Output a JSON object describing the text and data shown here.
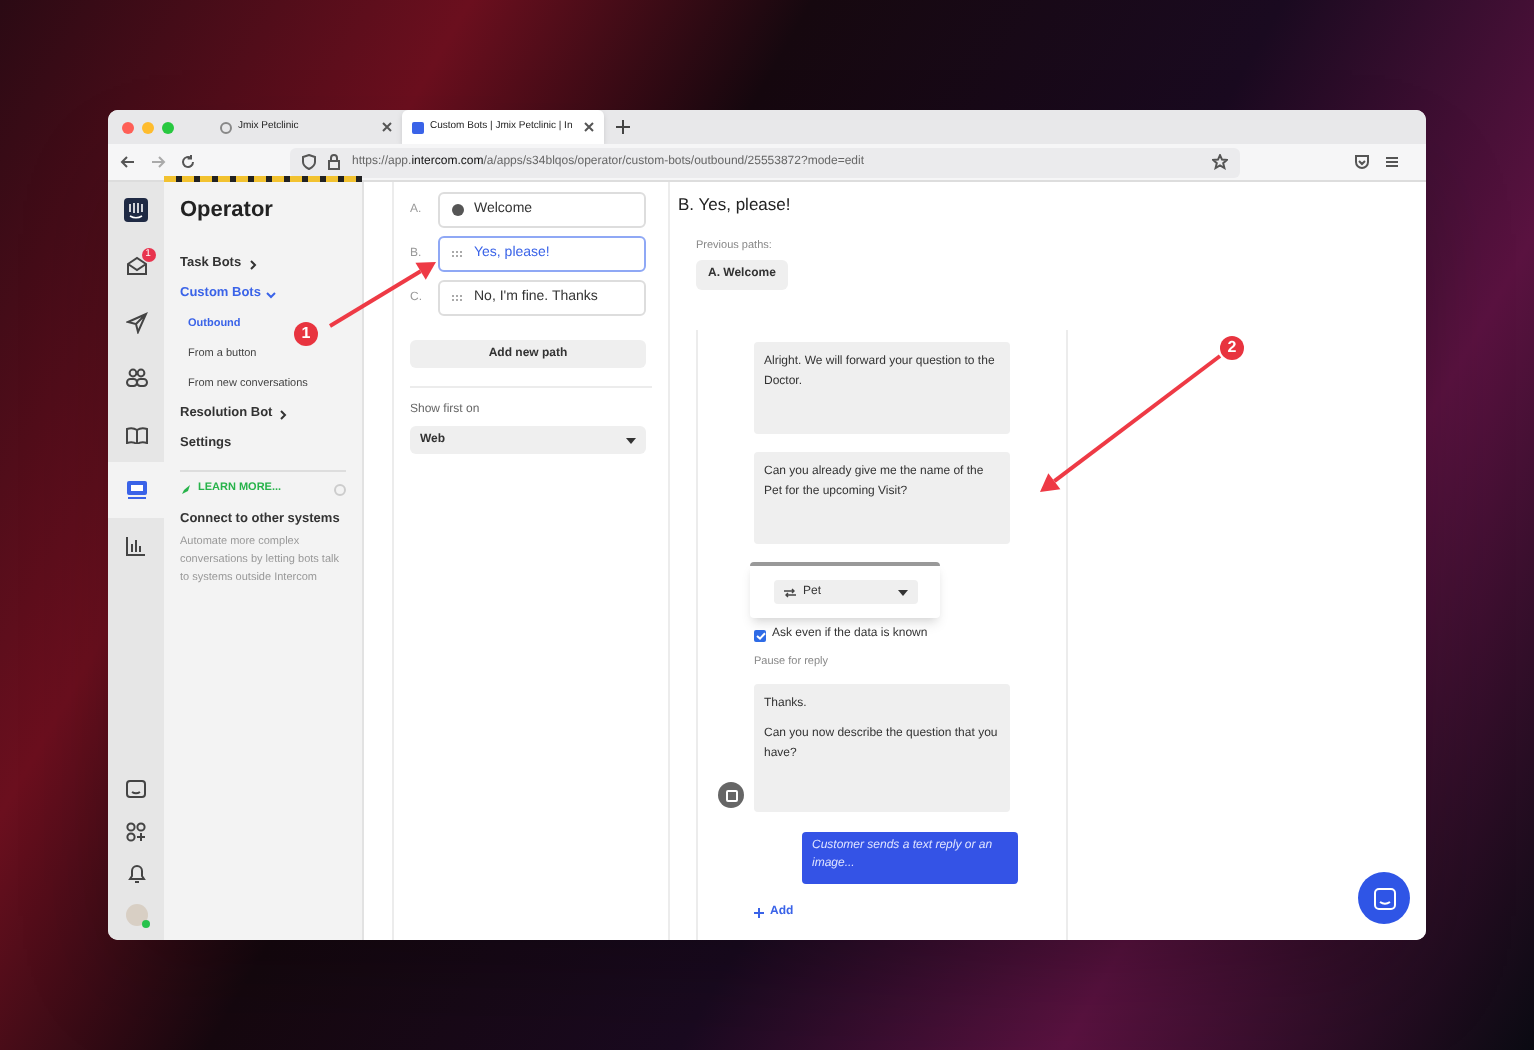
{
  "browser": {
    "tabs": [
      {
        "title": "Jmix Petclinic",
        "selected": false
      },
      {
        "title": "Custom Bots | Jmix Petclinic | In",
        "selected": true
      }
    ],
    "url": "https://app.**intercom.com**/a/apps/s34blqos/operator/custom-bots/outbound/25553872?mode=edit"
  },
  "rail": {
    "top": [
      {
        "kind": "logo",
        "selected": false
      },
      {
        "kind": "inbox",
        "badge": "1",
        "selected": false
      },
      {
        "kind": "outbound",
        "selected": false
      },
      {
        "kind": "contacts",
        "selected": false
      },
      {
        "kind": "articles",
        "selected": false
      },
      {
        "kind": "operator",
        "selected": true
      },
      {
        "kind": "reports",
        "selected": false
      }
    ],
    "bottom": [
      {
        "kind": "messenger",
        "selected": false
      },
      {
        "kind": "apps",
        "selected": false
      },
      {
        "kind": "notifications",
        "selected": false
      },
      {
        "kind": "avatar",
        "selected": false
      }
    ]
  },
  "sidebar": {
    "title": "Operator",
    "items": [
      {
        "label": "Task Bots",
        "expanded": false,
        "selected": false
      },
      {
        "label": "Custom Bots",
        "expanded": true,
        "selected": true,
        "children": [
          {
            "label": "Outbound",
            "selected": true
          },
          {
            "label": "From a button",
            "selected": false
          },
          {
            "label": "From new conversations",
            "selected": false
          }
        ]
      },
      {
        "label": "Resolution Bot",
        "expanded": false,
        "selected": false
      },
      {
        "label": "Settings",
        "selected": false
      }
    ],
    "learn_more": "LEARN MORE...",
    "promo_title": "Connect to other systems",
    "promo_text": "Automate more complex conversations by letting bots talk to systems outside Intercom"
  },
  "paths": {
    "items": [
      {
        "letter": "A.",
        "label": "Welcome",
        "kind": "welcome",
        "selected": false
      },
      {
        "letter": "B.",
        "label": "Yes, please!",
        "kind": "path",
        "selected": true
      },
      {
        "letter": "C.",
        "label": "No, I'm fine. Thanks",
        "kind": "path",
        "selected": false
      }
    ],
    "add_button": "Add new path",
    "show_first_label": "Show first on",
    "show_first_value": "Web"
  },
  "detail": {
    "title": "B. Yes, please!",
    "previous_label": "Previous paths:",
    "previous_paths": [
      "A. Welcome"
    ],
    "steps": [
      {
        "kind": "bubble",
        "paragraphs": [
          "Alright. We will forward your question to the Doctor."
        ]
      },
      {
        "kind": "bubble",
        "paragraphs": [
          "Can you already give me the name of the Pet for the upcoming Visit?"
        ]
      },
      {
        "kind": "attribute",
        "value": "Pet"
      },
      {
        "kind": "checkbox",
        "label": "Ask even if the data is known",
        "checked": true
      },
      {
        "kind": "note",
        "text": "Pause for reply"
      },
      {
        "kind": "bubble",
        "paragraphs": [
          "Thanks.",
          "Can you now describe the question that you have?"
        ],
        "avatar": true
      },
      {
        "kind": "reply",
        "text": "Customer sends a text reply or an image..."
      },
      {
        "kind": "add",
        "text": "Add"
      }
    ]
  },
  "annotations": [
    {
      "number": "1"
    },
    {
      "number": "2"
    }
  ]
}
